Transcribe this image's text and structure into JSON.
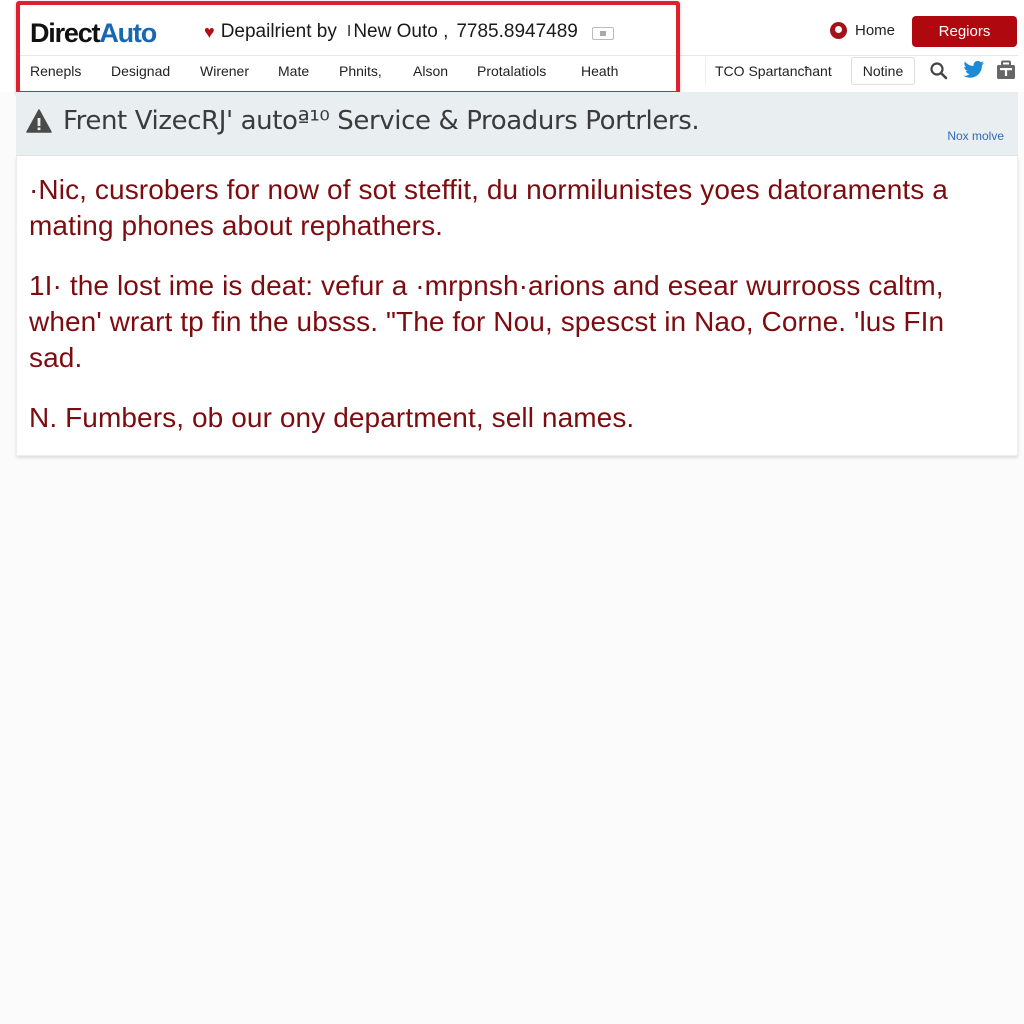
{
  "header": {
    "logo": {
      "part1": "Direct",
      "part2": "Auto"
    },
    "tagline": {
      "icon": "heart-icon",
      "text": "Depailrient by",
      "separator": "I",
      "location": "New Outo ,",
      "phone": "7785.8947489",
      "chat_icon": "chat-icon"
    },
    "home_link": {
      "icon": "location-pin-icon",
      "label": "Home"
    },
    "regions_button": "Regiors",
    "nav_items": [
      "Renepls",
      "Designad",
      "Wirener",
      "Mate",
      "Phnits,",
      "Alson",
      "Protalatiols",
      "Heath"
    ],
    "tco_link": "TCO Spartancħant",
    "notine_button": "Notine",
    "icons": [
      "search-icon",
      "twitter-icon",
      "briefcase-icon"
    ]
  },
  "banner": {
    "icon": "warning-icon",
    "title": "Frent VizecRJ' autoª¹⁰ Service & Proadurs Portrlers.",
    "link": "Nox molve"
  },
  "content": {
    "paragraphs": [
      "·Nic, cusrobers for now of sot steffit, du normilunistes yoes datoraments a mating phones about rephathers.",
      "1I· the lost ime is deat: vefur a ·mrpnsh·arions and esear wurrooss caltm, when' wrart tp fin the ubsss. \"The for Nou, spescst in Nao, Corne. 'lus FIn sad.",
      "N. Fumbers, ob our ony department, sell names."
    ]
  },
  "colors": {
    "accent_red": "#b0080f",
    "highlight_red": "#e0202c",
    "body_text": "#7d0c10",
    "link_blue": "#2d6bb4",
    "logo_blue": "#1767b2",
    "banner_bg": "#e9eef1"
  }
}
